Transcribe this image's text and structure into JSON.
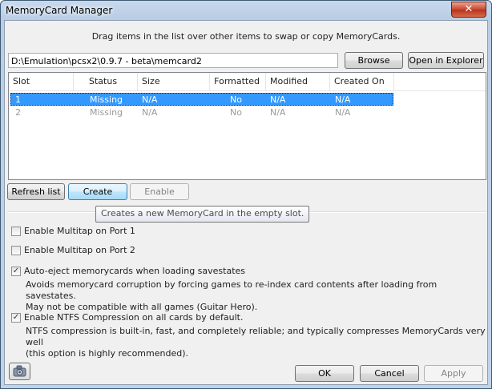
{
  "window": {
    "title": "MemoryCard Manager",
    "close_glyph": "✕"
  },
  "hint": "Drag items in the list over other items to swap or copy MemoryCards.",
  "path": {
    "value": "D:\\Emulation\\pcsx2\\0.9.7 - beta\\memcard2"
  },
  "buttons": {
    "browse": "Browse",
    "open_explorer": "Open in Explorer",
    "refresh": "Refresh list",
    "create": "Create",
    "enable": "Enable",
    "ok": "OK",
    "cancel": "Cancel",
    "apply": "Apply"
  },
  "list": {
    "columns": [
      "Slot",
      "Status",
      "Size",
      "Formatted",
      "Modified",
      "Created On"
    ],
    "rows": [
      {
        "slot": "1",
        "status": "Missing",
        "size": "N/A",
        "formatted": "No",
        "modified": "N/A",
        "created": "N/A",
        "selected": true
      },
      {
        "slot": "2",
        "status": "Missing",
        "size": "N/A",
        "formatted": "No",
        "modified": "N/A",
        "created": "N/A",
        "selected": false
      }
    ]
  },
  "tooltip": "Creates a new MemoryCard in the empty slot.",
  "options": {
    "multitap1": {
      "label": "Enable Multitap on Port 1",
      "checked": false
    },
    "multitap2": {
      "label": "Enable Multitap on Port 2",
      "checked": false
    },
    "autoeject": {
      "label": "Auto-eject memorycards when loading savestates",
      "checked": true,
      "desc1": "Avoids memorycard corruption by forcing games to re-index card contents after loading from savestates.",
      "desc2": "May not be compatible with all games (Guitar Hero)."
    },
    "ntfs": {
      "label": "Enable NTFS Compression on all cards by default.",
      "checked": true,
      "desc1": "NTFS compression is built-in, fast, and completely reliable; and typically compresses MemoryCards very well",
      "desc2": "(this option is highly recommended)."
    }
  },
  "icons": {
    "camera": "camera-icon",
    "checkmark": "✓"
  },
  "colors": {
    "selection": "#3399ff",
    "title_bar": "#b9cde4"
  }
}
